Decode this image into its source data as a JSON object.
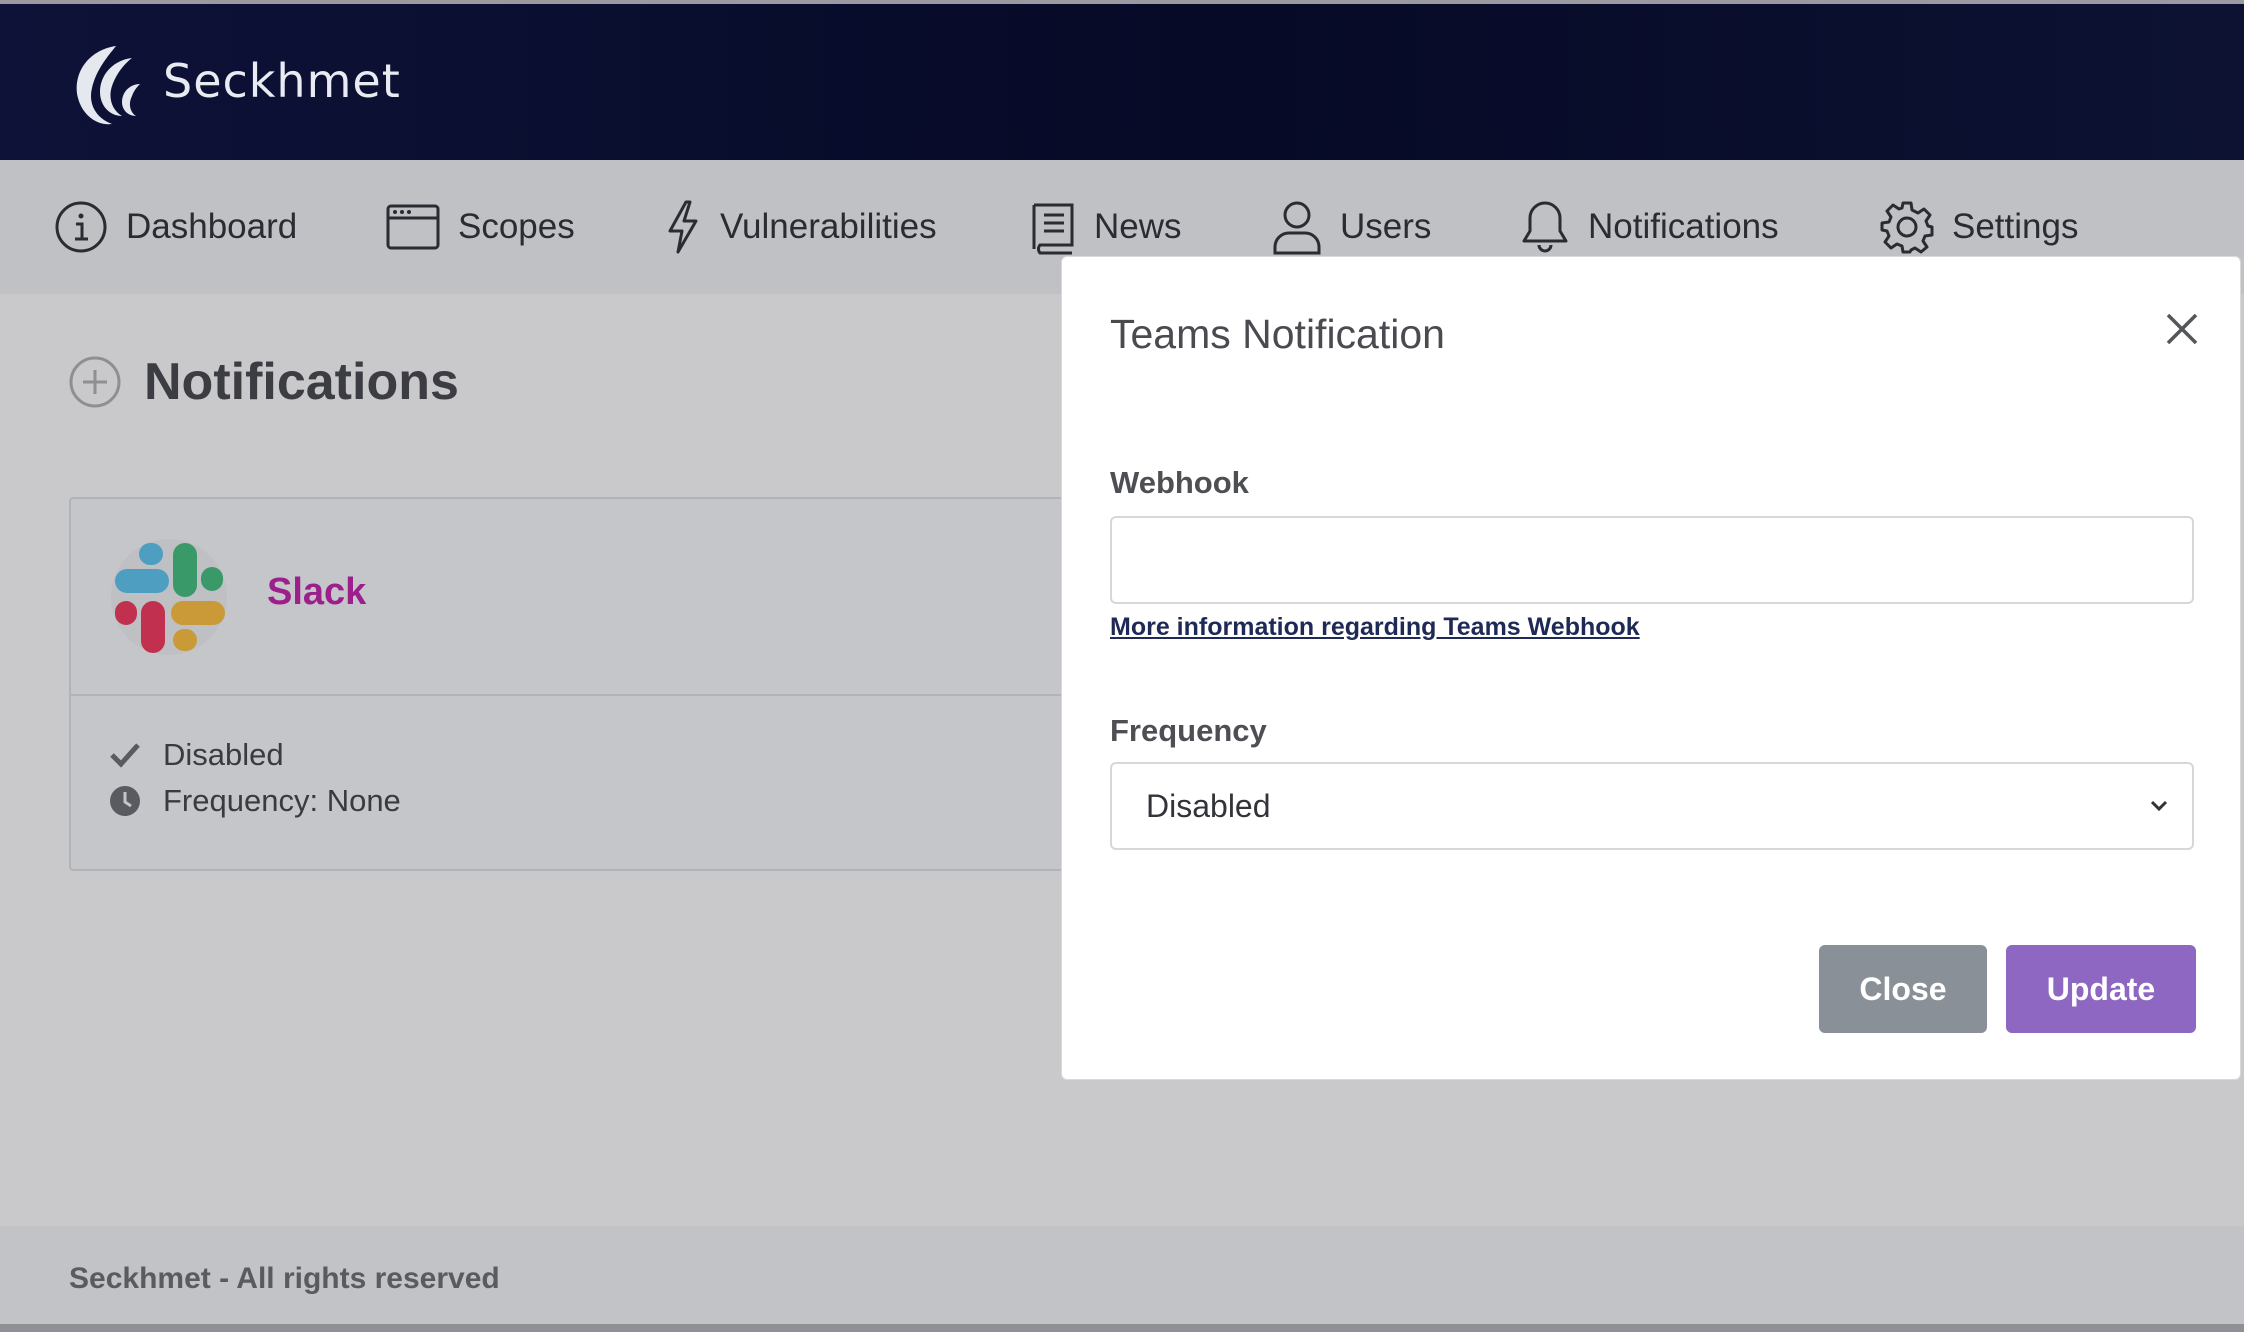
{
  "app": {
    "brand": "Seckhmet",
    "colors": {
      "header_bg": "#070b28",
      "accent_purple": "#8e67c2",
      "slack_text": "#9c1f8c"
    }
  },
  "nav": {
    "items": [
      {
        "label": "Dashboard",
        "icon": "info-circle-icon"
      },
      {
        "label": "Scopes",
        "icon": "browser-window-icon"
      },
      {
        "label": "Vulnerabilities",
        "icon": "lightning-icon"
      },
      {
        "label": "News",
        "icon": "book-icon"
      },
      {
        "label": "Users",
        "icon": "user-icon"
      },
      {
        "label": "Notifications",
        "icon": "bell-icon"
      },
      {
        "label": "Settings",
        "icon": "gear-icon"
      }
    ]
  },
  "page": {
    "title": "Notifications",
    "add_icon": "plus-circle-icon"
  },
  "card": {
    "name": "Slack",
    "status": "Disabled",
    "frequency": "Frequency: None"
  },
  "modal": {
    "title": "Teams Notification",
    "webhook_label": "Webhook",
    "webhook_value": "",
    "help_link": "More information regarding Teams Webhook",
    "frequency_label": "Frequency",
    "frequency_value": "Disabled",
    "close_label": "Close",
    "update_label": "Update"
  },
  "footer": {
    "text": "Seckhmet - All rights reserved"
  }
}
